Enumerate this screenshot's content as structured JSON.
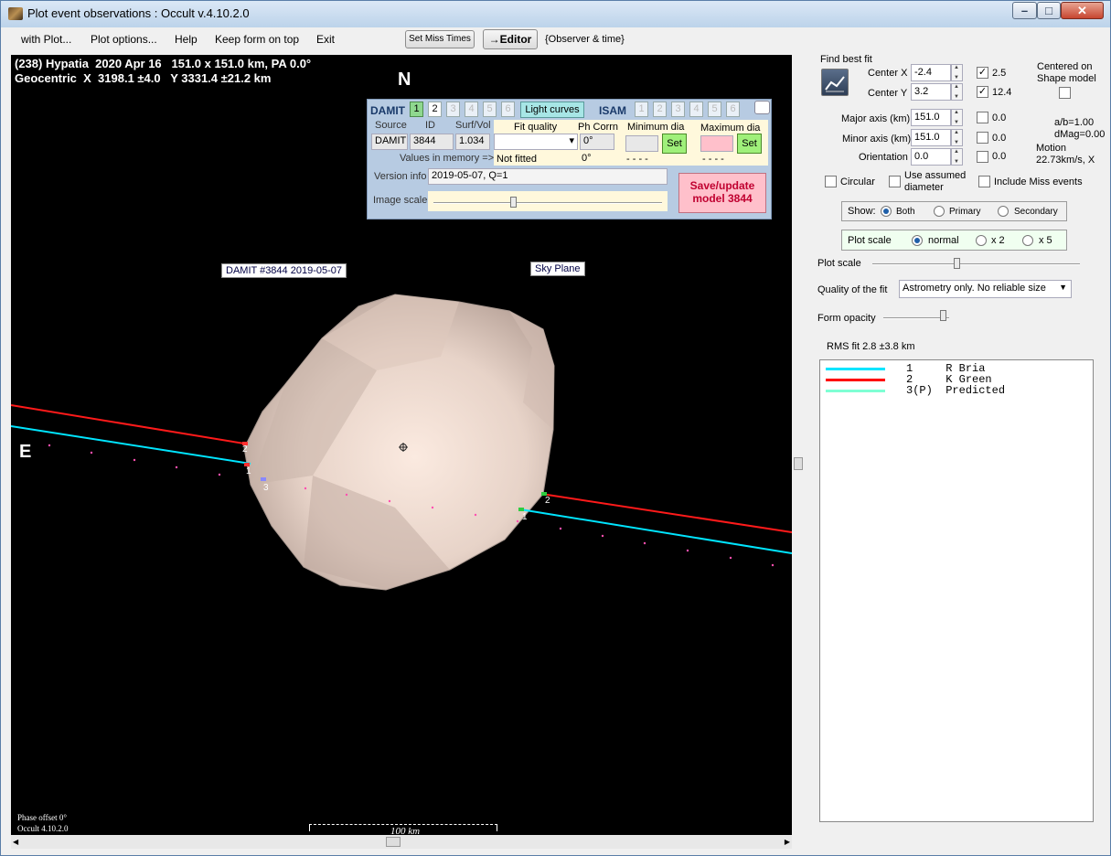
{
  "window": {
    "title": "Plot event observations : Occult v.4.10.2.0"
  },
  "menu": {
    "items": [
      "with Plot...",
      "Plot options...",
      "Help",
      "Keep form on top",
      "Exit"
    ],
    "set_miss_times": "Set Miss Times",
    "editor": "→Editor",
    "observer_time": "{Observer & time}"
  },
  "plot": {
    "header1": "(238) Hypatia  2020 Apr 16   151.0 x 151.0 km, PA 0.0°",
    "header2": "Geocentric  X  3198.1 ±4.0   Y 3331.4 ±21.2 km",
    "north": "N",
    "east": "E",
    "damit_label": "DAMIT #3844 2019-05-07",
    "sky_plane": "Sky Plane",
    "phase_offset": "Phase offset 0°",
    "version_footer": "Occult 4.10.2.0",
    "scale_label": "100 km",
    "chord_labels": [
      "2",
      "1",
      "3",
      "2",
      "1"
    ]
  },
  "damit_panel": {
    "title": "DAMIT",
    "buttons": [
      "1",
      "2",
      "3",
      "4",
      "5",
      "6"
    ],
    "light_curves": "Light curves",
    "isam": "ISAM",
    "col_source": "Source",
    "col_id": "ID",
    "col_surf": "Surf/Vol",
    "source": "DAMIT",
    "id": "3844",
    "surf_vol": "1.034",
    "col_fit": "Fit quality",
    "col_phcorr": "Ph Corrn",
    "col_min": "Minimum dia",
    "col_max": "Maximum dia",
    "ph_corr": "0°",
    "values_in_memory": "Values in memory =>",
    "not_fitted": "Not fitted",
    "ph_mem": "0°",
    "min_mem": "- - - -",
    "max_mem": "- - - -",
    "set": "Set",
    "version_label": "Version info",
    "version": "2019-05-07, Q=1",
    "image_scale": "Image scale",
    "save": "Save/update model 3844"
  },
  "right": {
    "find_best_fit": "Find best fit",
    "center_x_label": "Center X",
    "center_x": "-2.4",
    "center_x_unc": "2.5",
    "center_y_label": "Center Y",
    "center_y": "3.2",
    "center_y_unc": "12.4",
    "centered_on": "Centered on",
    "shape_model": "Shape model",
    "major_label": "Major axis (km)",
    "major": "151.0",
    "major_unc": "0.0",
    "minor_label": "Minor axis (km)",
    "minor": "151.0",
    "minor_unc": "0.0",
    "orient_label": "Orientation",
    "orient": "0.0",
    "orient_unc": "0.0",
    "ab": "a/b=1.00",
    "dmag": "dMag=0.00",
    "motion": "Motion",
    "motion_val": "22.73km/s, X",
    "circular": "Circular",
    "use_assumed": "Use assumed",
    "diameter": "diameter",
    "include_miss": "Include Miss events",
    "show": "Show:",
    "both": "Both",
    "primary": "Primary",
    "secondary": "Secondary",
    "plot_scale": "Plot scale",
    "normal": "normal",
    "x2": "x 2",
    "x5": "x 5",
    "plot_scale_slider": "Plot scale",
    "quality_label": "Quality of the fit",
    "quality": "Astrometry only. No reliable size",
    "form_opacity": "Form opacity",
    "rms": "RMS fit 2.8 ±3.8 km"
  },
  "legend": [
    {
      "num": "1",
      "name": "R Bria",
      "color": "#00e5ff"
    },
    {
      "num": "2",
      "name": "K Green",
      "color": "#ff0000"
    },
    {
      "num": "3(P)",
      "name": "Predicted",
      "color": "#7fffd4"
    }
  ]
}
